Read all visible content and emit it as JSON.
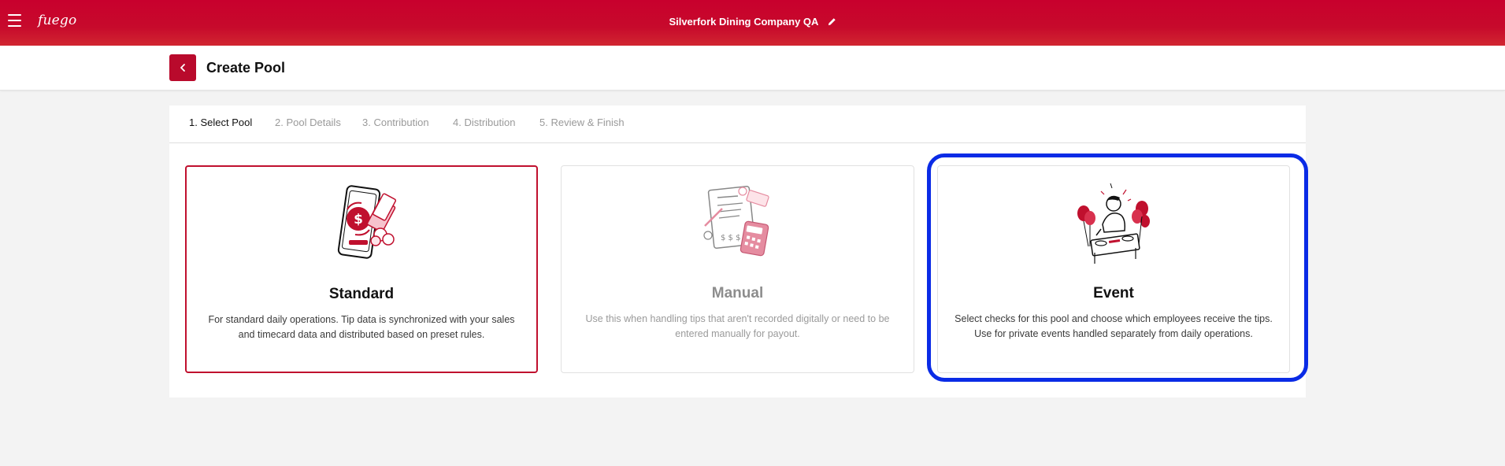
{
  "topbar": {
    "menu_icon": "hamburger-menu-icon",
    "logo_text": "fuego",
    "company_name": "Silverfork Dining Company QA",
    "edit_icon": "pencil-icon"
  },
  "header": {
    "back_icon": "chevron-left-icon",
    "title": "Create Pool"
  },
  "steps": [
    {
      "label": "1. Select Pool",
      "active": true
    },
    {
      "label": "2. Pool Details",
      "active": false
    },
    {
      "label": "3. Contribution",
      "active": false
    },
    {
      "label": "4. Distribution",
      "active": false
    },
    {
      "label": "5. Review & Finish",
      "active": false
    }
  ],
  "cards": [
    {
      "title": "Standard",
      "description": "For standard daily operations. Tip data is synchronized with your sales and timecard data and distributed based on preset rules.",
      "icon": "phone-payment-illustration",
      "state": "selected"
    },
    {
      "title": "Manual",
      "description": "Use this when handling tips that aren't recorded digitally or need to be entered manually for payout.",
      "icon": "document-calculator-illustration",
      "state": "disabled"
    },
    {
      "title": "Event",
      "description": "Select checks for this pool and choose which employees receive the tips. Use for private events handled separately from daily operations.",
      "icon": "dj-party-illustration",
      "state": "default"
    }
  ],
  "colors": {
    "brand": "#c8002d",
    "highlight": "#0a2be6",
    "background": "#f3f3f3"
  }
}
